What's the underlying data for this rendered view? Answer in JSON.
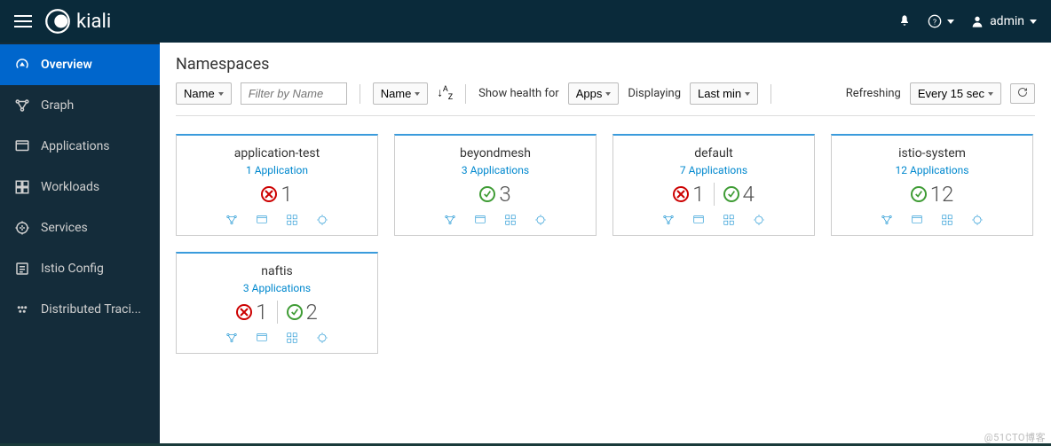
{
  "app_name": "kiali",
  "user_name": "admin",
  "sidebar": {
    "items": [
      {
        "label": "Overview"
      },
      {
        "label": "Graph"
      },
      {
        "label": "Applications"
      },
      {
        "label": "Workloads"
      },
      {
        "label": "Services"
      },
      {
        "label": "Istio Config"
      },
      {
        "label": "Distributed Traci..."
      }
    ]
  },
  "page_title": "Namespaces",
  "toolbar": {
    "name_select_1": "Name",
    "filter_placeholder": "Filter by Name",
    "name_select_2": "Name",
    "health_label": "Show health for",
    "health_select": "Apps",
    "displaying_label": "Displaying",
    "displaying_select": "Last min",
    "refreshing_label": "Refreshing",
    "refreshing_select": "Every 15 sec"
  },
  "cards": [
    {
      "title": "application-test",
      "apps_label": "1 Application",
      "stats": [
        {
          "type": "error",
          "count": 1
        }
      ]
    },
    {
      "title": "beyondmesh",
      "apps_label": "3 Applications",
      "stats": [
        {
          "type": "ok",
          "count": 3
        }
      ]
    },
    {
      "title": "default",
      "apps_label": "7 Applications",
      "stats": [
        {
          "type": "error",
          "count": 1
        },
        {
          "type": "ok",
          "count": 4
        }
      ]
    },
    {
      "title": "istio-system",
      "apps_label": "12 Applications",
      "stats": [
        {
          "type": "ok",
          "count": 12
        }
      ]
    },
    {
      "title": "naftis",
      "apps_label": "3 Applications",
      "stats": [
        {
          "type": "error",
          "count": 1
        },
        {
          "type": "ok",
          "count": 2
        }
      ]
    }
  ],
  "watermark": "@51CTO博客"
}
